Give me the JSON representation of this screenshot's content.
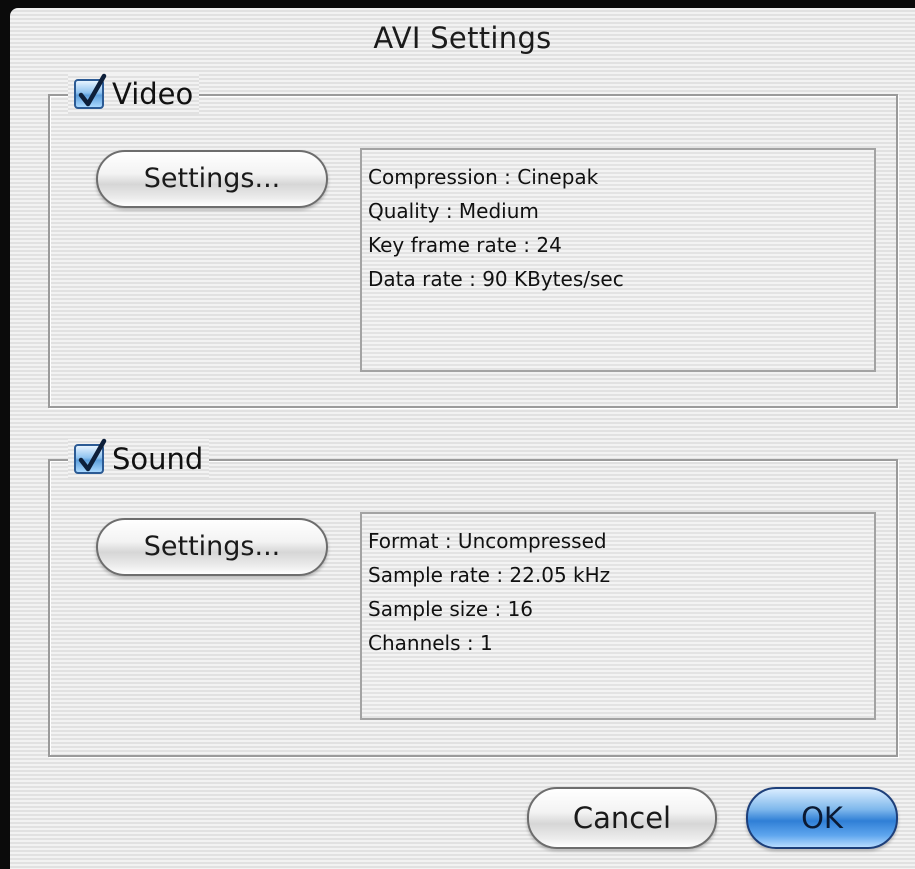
{
  "window": {
    "title": "AVI Settings"
  },
  "video": {
    "label": "Video",
    "checked": true,
    "settings_button": "Settings...",
    "info": [
      "Compression : Cinepak",
      "Quality : Medium",
      "Key frame rate : 24",
      "Data rate : 90 KBytes/sec"
    ]
  },
  "sound": {
    "label": "Sound",
    "checked": true,
    "settings_button": "Settings...",
    "info": [
      "Format : Uncompressed",
      "Sample rate : 22.05 kHz",
      "Sample size : 16",
      "Channels : 1"
    ]
  },
  "buttons": {
    "cancel": "Cancel",
    "ok": "OK"
  },
  "icons": {
    "checkbox": "checkmark-icon"
  },
  "colors": {
    "accent": "#2f7fd6",
    "checkbox_border": "#2b5a94"
  }
}
